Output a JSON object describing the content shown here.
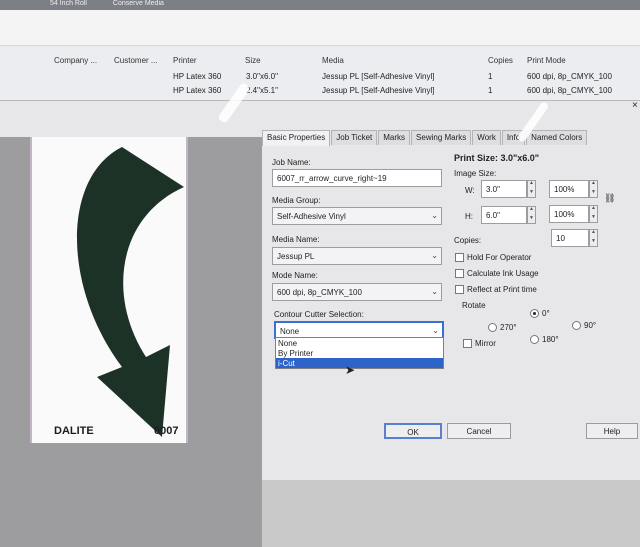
{
  "top_window": {
    "title_fragments": [
      "54 Inch Roll",
      "Conserve Media"
    ],
    "columns": [
      "Company ...",
      "Customer ...",
      "Printer",
      "Size",
      "Media",
      "Copies",
      "Print Mode"
    ],
    "rows": [
      {
        "printer": "HP Latex 360",
        "size": "3.0\"x6.0\"",
        "media": "Jessup PL [Self-Adhesive Vinyl]",
        "copies": "1",
        "mode": "600 dpi, 8p_CMYK_100"
      },
      {
        "printer": "HP Latex 360",
        "size": "2.4\"x5.1\"",
        "media": "Jessup PL [Self-Adhesive Vinyl]",
        "copies": "1",
        "mode": "600 dpi, 8p_CMYK_100"
      }
    ]
  },
  "dialog": {
    "tabs": [
      "Basic Properties",
      "Job Ticket",
      "Marks",
      "Sewing Marks",
      "Work",
      "Info",
      "Named Colors"
    ],
    "active_tab": 0,
    "preview": {
      "left_label": "DALITE",
      "right_label": "6007",
      "arrow_color": "#1d3227"
    },
    "job_name_label": "Job Name:",
    "job_name_value": "6007_rr_arrow_curve_right~19",
    "media_group_label": "Media Group:",
    "media_group_value": "Self-Adhesive Vinyl",
    "media_name_label": "Media Name:",
    "media_name_value": "Jessup PL",
    "mode_name_label": "Mode Name:",
    "mode_name_value": "600 dpi, 8p_CMYK_100",
    "contour_label": "Contour Cutter Selection:",
    "contour_value": "None",
    "contour_options": [
      "None",
      "By Printer",
      "i-Cut"
    ],
    "contour_selected": 2,
    "print_size_label": "Print Size: 3.0\"x6.0\"",
    "image_size_label": "Image Size:",
    "width_label": "W:",
    "width_value": "3.0\"",
    "width_pct": "100%",
    "height_label": "H:",
    "height_value": "6.0\"",
    "height_pct": "100%",
    "copies_label": "Copies:",
    "copies_value": "10",
    "hold_label": "Hold For Operator",
    "calc_label": "Calculate Ink Usage",
    "reflect_label": "Reflect at Print time",
    "rotate_label": "Rotate",
    "rot_0": "0°",
    "rot_90": "90°",
    "rot_180": "180°",
    "rot_270": "270°",
    "mirror_label": "Mirror",
    "ok_label": "OK",
    "cancel_label": "Cancel",
    "help_label": "Help",
    "accent": "#2e63c9"
  }
}
